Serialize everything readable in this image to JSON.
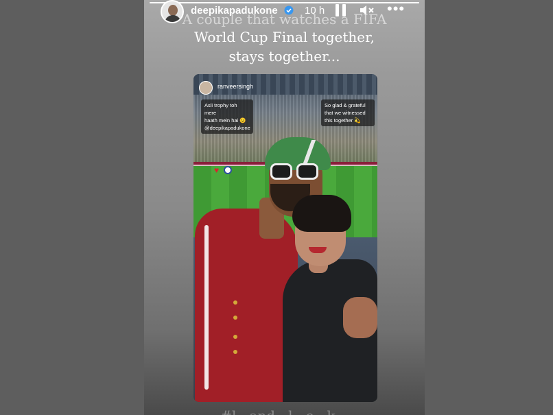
{
  "story": {
    "username": "deepikapadukone",
    "timestamp": "10 h",
    "progress": 1.0,
    "caption_lines": [
      "A couple that watches a FIFA",
      "World Cup Final together,",
      "stays together..."
    ],
    "bottom_caption": "#l...and...l...e...k...",
    "icons": {
      "verified": "verified-badge-icon",
      "pause": "pause-icon",
      "mute": "speaker-muted-icon",
      "more": "more-options-icon"
    }
  },
  "repost": {
    "username": "ranveersingh",
    "sticker_left": [
      "Asli trophy toh mere",
      "haath mein hai 😉",
      "@deepikapadukone"
    ],
    "sticker_right": [
      "So glad & grateful",
      "that we witnessed",
      "this together 💫"
    ]
  },
  "colors": {
    "accent_text": "#ffffff",
    "verified": "#3897f0"
  }
}
